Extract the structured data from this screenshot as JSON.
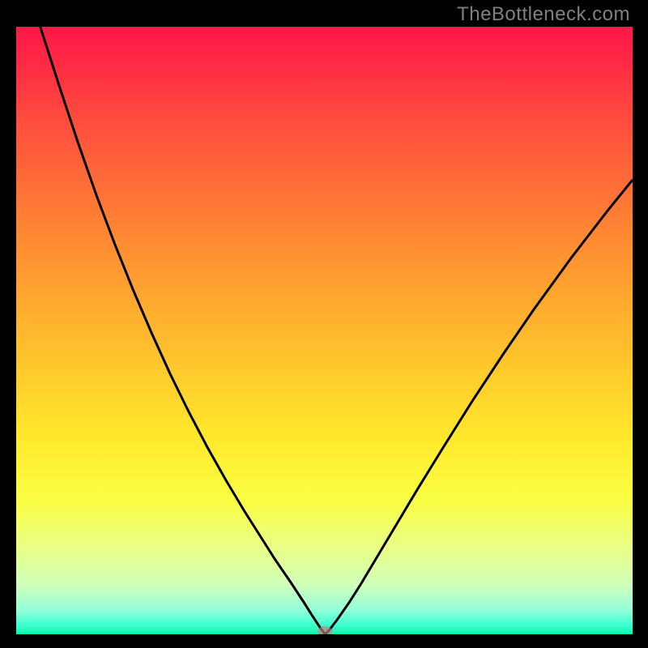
{
  "watermark": "TheBottleneck.com",
  "colors": {
    "page_bg": "#000000",
    "watermark": "#808080",
    "gradient_top": "#ff1848",
    "gradient_bottom": "#0ef6ac",
    "curve_stroke": "#000000",
    "marker_fill": "#c98080"
  },
  "chart_data": {
    "type": "line",
    "title": "",
    "xlabel": "",
    "ylabel": "",
    "xlim": [
      0,
      100
    ],
    "ylim": [
      0,
      100
    ],
    "grid": false,
    "legend": false,
    "x": [
      3.9,
      7,
      10,
      13,
      16,
      19,
      22,
      25,
      28,
      31,
      34,
      37,
      40,
      42,
      44.5,
      46.7,
      48,
      49.3,
      50.1,
      50.8,
      52,
      54,
      56,
      58,
      61,
      65,
      69,
      74,
      79,
      84,
      90,
      96,
      100
    ],
    "values": [
      100,
      90.2,
      81,
      72.3,
      64.2,
      56.6,
      49.5,
      42.8,
      36.6,
      30.8,
      25.4,
      20.3,
      15.5,
      12.3,
      8.6,
      5.2,
      3.1,
      1.1,
      0,
      0.7,
      2.3,
      5.2,
      8.4,
      11.8,
      16.9,
      23.7,
      30.3,
      38.4,
      46.1,
      53.5,
      61.9,
      69.8,
      74.8
    ],
    "marker": {
      "x": 50.1,
      "y": 0.4
    },
    "note": "V-shaped bottleneck curve; minimum at x≈50. Values are percentages estimated from pixel positions on a 0–100 scale."
  }
}
